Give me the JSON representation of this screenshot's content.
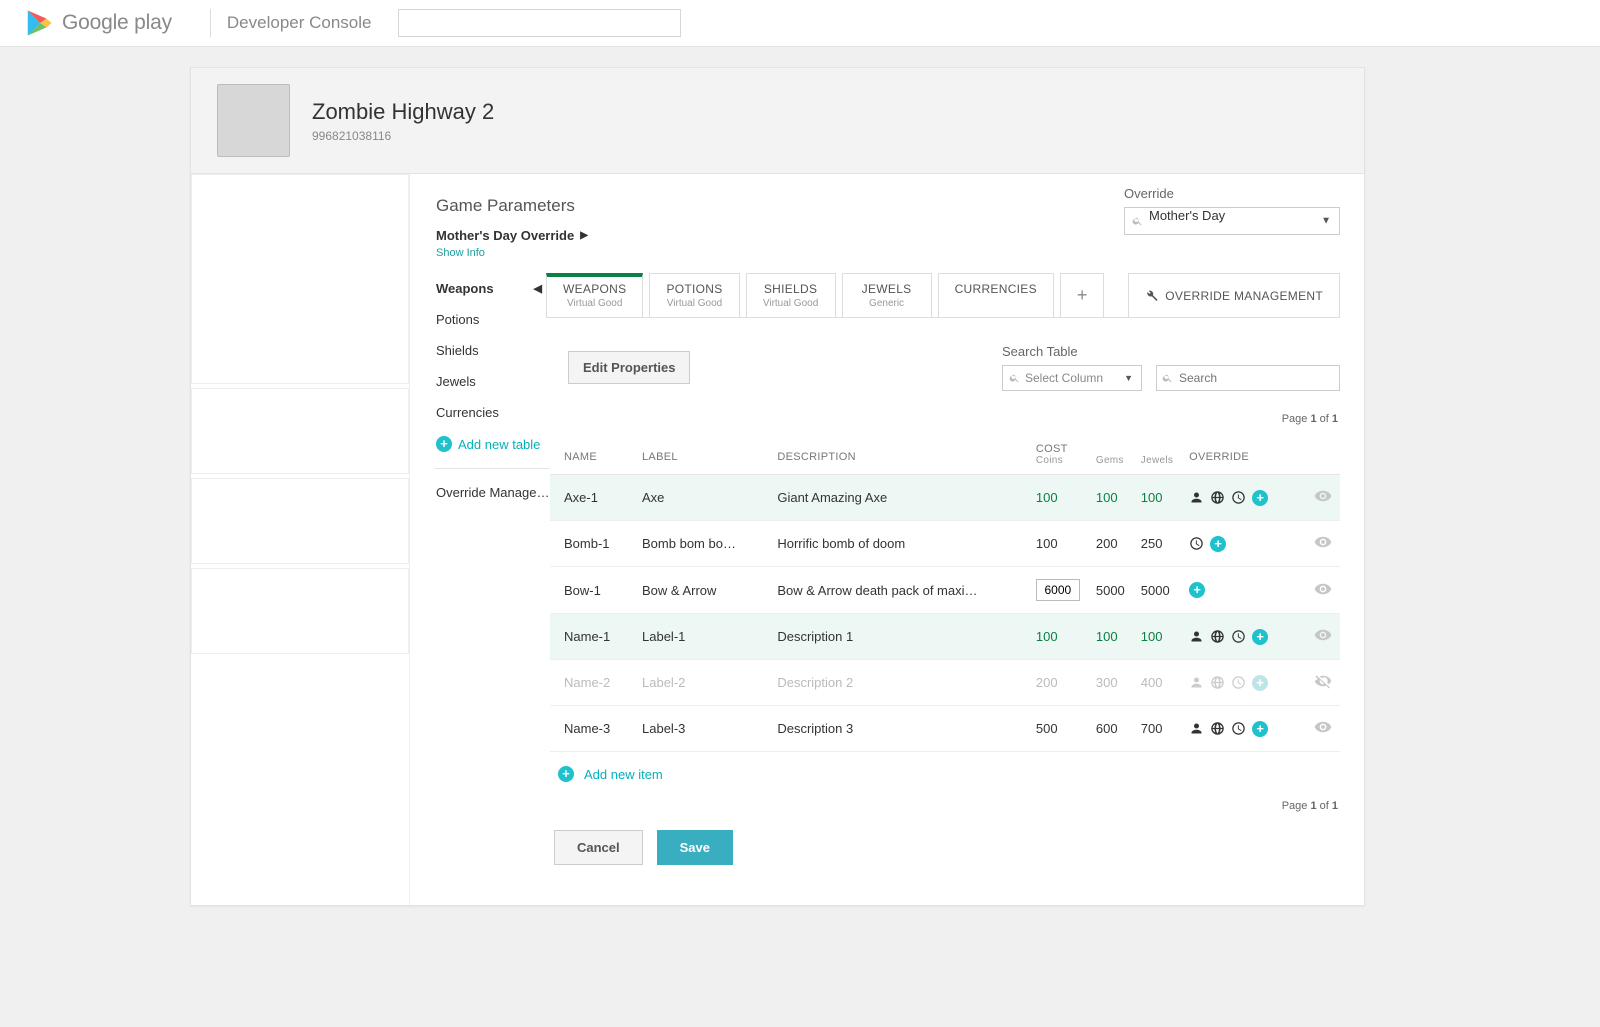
{
  "header": {
    "brand1": "Google",
    "brand2": "play",
    "console": "Developer Console"
  },
  "app": {
    "title": "Zombie Highway 2",
    "id": "996821038116"
  },
  "section": {
    "title": "Game Parameters",
    "breadcrumb": "Mother's Day Override",
    "show_info": "Show Info",
    "override_label": "Override",
    "override_value": "Mother's Day"
  },
  "sidenav": {
    "items": [
      "Weapons",
      "Potions",
      "Shields",
      "Jewels",
      "Currencies"
    ],
    "add_label": "Add new table",
    "om_label": "Override Management"
  },
  "tabs": [
    {
      "name": "WEAPONS",
      "sub": "Virtual Good",
      "active": true
    },
    {
      "name": "POTIONS",
      "sub": "Virtual Good"
    },
    {
      "name": "SHIELDS",
      "sub": "Virtual Good"
    },
    {
      "name": "JEWELS",
      "sub": "Generic"
    },
    {
      "name": "CURRENCIES",
      "sub": ""
    }
  ],
  "om_button": "OVERRIDE MANAGEMENT",
  "toolbar": {
    "edit_props": "Edit Properties",
    "search_label": "Search Table",
    "select_col_ph": "Select Column",
    "search_ph": "Search"
  },
  "pager": {
    "prefix": "Page ",
    "page": "1",
    "mid": " of ",
    "total": "1"
  },
  "columns": {
    "name": "NAME",
    "label": "LABEL",
    "description": "DESCRIPTION",
    "cost": "COST",
    "coins": "Coins",
    "gems": "Gems",
    "jewels": "Jewels",
    "override": "OVERRIDE"
  },
  "rows": [
    {
      "name": "Axe-1",
      "label": "Axe",
      "desc": "Giant Amazing Axe",
      "coins": "100",
      "gems": "100",
      "jewels": "100",
      "icons": [
        "person",
        "globe",
        "clock",
        "plus"
      ],
      "vis": "eye",
      "style": "green"
    },
    {
      "name": "Bomb-1",
      "label": "Bomb bom bo…",
      "desc": "Horrific bomb of doom",
      "coins": "100",
      "gems": "200",
      "jewels": "250",
      "icons": [
        "clock",
        "plus"
      ],
      "vis": "eye",
      "style": "plain"
    },
    {
      "name": "Bow-1",
      "label": "Bow & Arrow",
      "desc": "Bow & Arrow death pack of maxi…",
      "coins": "6000",
      "gems": "5000",
      "jewels": "5000",
      "icons": [
        "plus"
      ],
      "vis": "eye",
      "style": "edit"
    },
    {
      "name": "Name-1",
      "label": "Label-1",
      "desc": "Description 1",
      "coins": "100",
      "gems": "100",
      "jewels": "100",
      "icons": [
        "person",
        "globe",
        "clock",
        "plus"
      ],
      "vis": "eye",
      "style": "green"
    },
    {
      "name": "Name-2",
      "label": "Label-2",
      "desc": "Description 2",
      "coins": "200",
      "gems": "300",
      "jewels": "400",
      "icons": [
        "person",
        "globe",
        "clock",
        "plus"
      ],
      "vis": "eye-off",
      "style": "dim"
    },
    {
      "name": "Name-3",
      "label": "Label-3",
      "desc": "Description 3",
      "coins": "500",
      "gems": "600",
      "jewels": "700",
      "icons": [
        "person",
        "globe",
        "clock",
        "plus"
      ],
      "vis": "eye",
      "style": "plain"
    }
  ],
  "add_item": "Add new item",
  "buttons": {
    "cancel": "Cancel",
    "save": "Save"
  }
}
